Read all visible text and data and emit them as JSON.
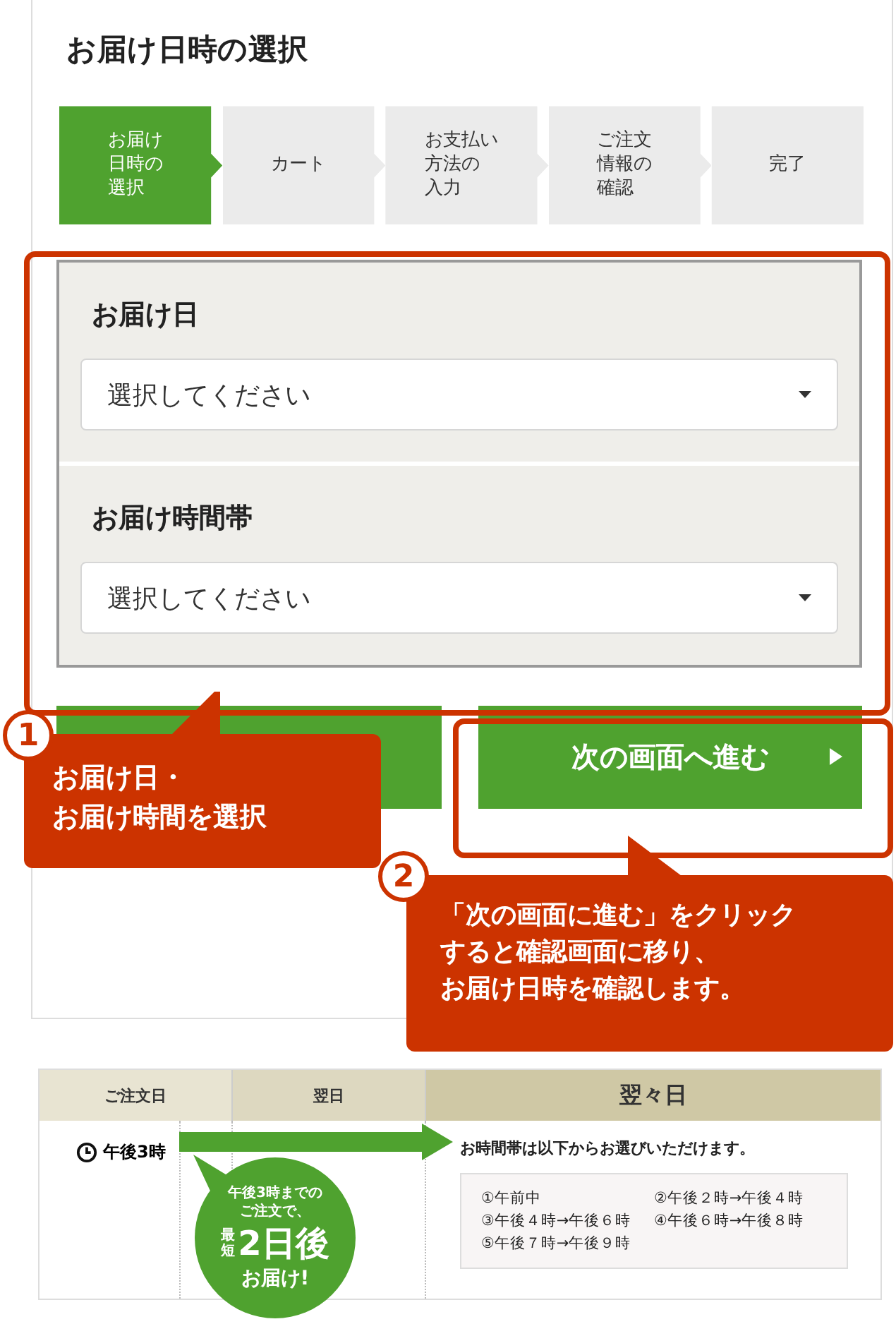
{
  "page_title": "お届け日時の選択",
  "steps": [
    {
      "lines": [
        "お届け",
        "日時の",
        "選択"
      ],
      "selected": true
    },
    {
      "lines": [
        "カート"
      ],
      "selected": false
    },
    {
      "lines": [
        "お支払い",
        "方法の",
        "入力"
      ],
      "selected": false
    },
    {
      "lines": [
        "ご注文",
        "情報の",
        "確認"
      ],
      "selected": false
    },
    {
      "lines": [
        "完了"
      ],
      "selected": false
    }
  ],
  "form_sections": [
    {
      "label": "お届け日",
      "placeholder": "選択してください"
    },
    {
      "label": "お届け時間帯",
      "placeholder": "選択してください"
    }
  ],
  "buttons": [
    {
      "kind": "back"
    },
    {
      "kind": "next",
      "label": "次の画面へ進む"
    }
  ],
  "callouts": [
    {
      "number": "1",
      "lines": [
        "お届け日・",
        "お届け時間を選択"
      ]
    },
    {
      "number": "2",
      "lines": [
        "「次の画面に進む」をクリック",
        "すると確認画面に移り、",
        "お届け日時を確認します。"
      ]
    }
  ],
  "schedule": {
    "columns": [
      "ご注文日",
      "翌日",
      "翌々日"
    ],
    "order_time": "午後3時",
    "bubble": {
      "intro": [
        "午後3時までの",
        "ご注文で、"
      ],
      "prefix": "最短",
      "main": "2日後",
      "suffix": "お届け!"
    },
    "message": "お時間帯は以下からお選びいただけます。",
    "slots": [
      "①午前中",
      "②午後２時→午後４時",
      "③午後４時→午後６時",
      "④午後６時→午後８時",
      "⑤午後７時→午後９時"
    ]
  }
}
